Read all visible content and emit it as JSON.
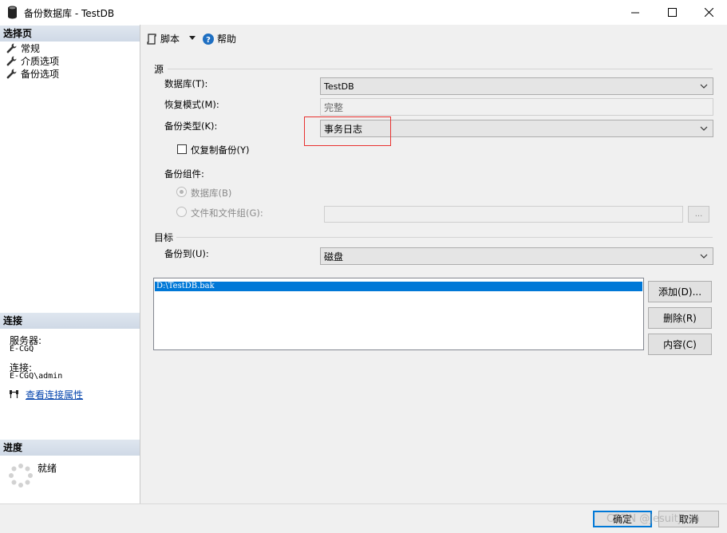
{
  "window": {
    "title": "备份数据库 - TestDB",
    "minimize_icon": "minimize-icon",
    "maximize_icon": "maximize-icon",
    "close_icon": "close-icon"
  },
  "left": {
    "select_page_header": "选择页",
    "pages": [
      {
        "label": "常规",
        "icon": "wrench-icon"
      },
      {
        "label": "介质选项",
        "icon": "wrench-icon"
      },
      {
        "label": "备份选项",
        "icon": "wrench-icon"
      }
    ],
    "connection_header": "连接",
    "server_label": "服务器:",
    "server_value": "E-CGQ",
    "connection_label": "连接:",
    "connection_value": "E-CGQ\\admin",
    "view_connection_link": "查看连接属性",
    "progress_header": "进度",
    "progress_status": "就绪"
  },
  "toolbar": {
    "script_label": "脚本",
    "help_label": "帮助"
  },
  "source": {
    "group_label": "源",
    "database_label": "数据库(T):",
    "database_value": "TestDB",
    "recovery_label": "恢复模式(M):",
    "recovery_value": "完整",
    "backup_type_label": "备份类型(K):",
    "backup_type_value": "事务日志",
    "copy_only_label": "仅复制备份(Y)",
    "copy_only_checked": false,
    "component_label": "备份组件:",
    "component_database": "数据库(B)",
    "component_files": "文件和文件组(G):",
    "browse_label": "..."
  },
  "destination": {
    "group_label": "目标",
    "backup_to_label": "备份到(U):",
    "backup_to_value": "磁盘",
    "paths": [
      "D:\\TestDB.bak"
    ],
    "add_button": "添加(D)...",
    "remove_button": "删除(R)",
    "contents_button": "内容(C)"
  },
  "footer": {
    "ok_button": "确定",
    "cancel_button": "取消",
    "watermark": "CSDN @Jesuitjava"
  },
  "colors": {
    "accent": "#0078d7",
    "highlight": "#e8312f",
    "section_header": "#d6dfea"
  }
}
